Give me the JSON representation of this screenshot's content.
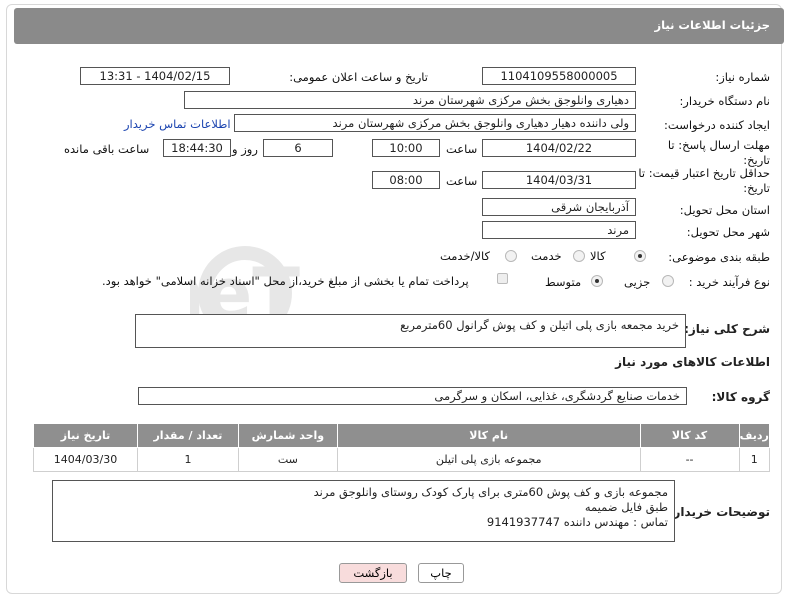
{
  "header": {
    "title": "جزئیات اطلاعات نیاز"
  },
  "need_number": {
    "label": "شماره نیاز:",
    "value": "1104109558000005"
  },
  "announce_datetime": {
    "label": "تاریخ و ساعت اعلان عمومی:",
    "value": "1404/02/15 - 13:31"
  },
  "buyer_org": {
    "label": "نام دستگاه خریدار:",
    "value": "دهیاری وانلوجق بخش مرکزی شهرستان مرند"
  },
  "requester": {
    "label": "ایجاد کننده درخواست:",
    "value": "ولی داننده دهیار دهیاری وانلوجق بخش مرکزی شهرستان مرند",
    "contact_link": "اطلاعات تماس خریدار"
  },
  "reply_deadline": {
    "label": "مهلت ارسال پاسخ: تا تاریخ:",
    "date": "1404/02/22",
    "time_label": "ساعت",
    "time": "10:00",
    "days": "6",
    "days_label": "روز و",
    "remaining": "18:44:30",
    "remaining_label": "ساعت باقی مانده"
  },
  "price_validity": {
    "label": "حداقل تاریخ اعتبار قیمت: تا تاریخ:",
    "date": "1404/03/31",
    "time_label": "ساعت",
    "time": "08:00"
  },
  "delivery_province": {
    "label": "استان محل تحویل:",
    "value": "آذربایجان شرقی"
  },
  "delivery_city": {
    "label": "شهر محل تحویل:",
    "value": "مرند"
  },
  "category": {
    "label": "طبقه بندی موضوعی:",
    "options": [
      "کالا",
      "خدمت",
      "کالا/خدمت"
    ],
    "selected": "کالا"
  },
  "purchase_process": {
    "label": "نوع فرآیند خرید :",
    "options": [
      "جزیی",
      "متوسط"
    ],
    "selected": "متوسط",
    "note": "پرداخت تمام یا بخشی از مبلغ خرید،از محل \"اسناد خزانه اسلامی\" خواهد بود."
  },
  "description": {
    "label": "شرح کلی نیاز:",
    "value": "خرید مجمعه بازی پلی اتیلن و کف پوش گرانول 60مترمربع"
  },
  "items_section": {
    "title": "اطلاعات کالاهای مورد نیاز"
  },
  "goods_group": {
    "label": "گروه کالا:",
    "value": "خدمات صنایع گردشگری، غذایی، اسکان و سرگرمی"
  },
  "table": {
    "headers": [
      "ردیف",
      "کد کالا",
      "نام کالا",
      "واحد شمارش",
      "تعداد / مقدار",
      "تاریخ نیاز"
    ],
    "rows": [
      [
        "1",
        "--",
        "مجموعه بازی پلی اتیلن",
        "ست",
        "1",
        "1404/03/30"
      ]
    ]
  },
  "buyer_notes": {
    "label": "توضیحات خریدار:",
    "lines": [
      "مجموعه بازی و کف پوش 60متری برای پارک کودک روستای وانلوجق مرند",
      "طبق فایل ضمیمه",
      "تماس : مهندس داننده 9141937747"
    ]
  },
  "buttons": {
    "print": "چاپ",
    "back": "بازگشت"
  },
  "watermark": {
    "text": "AriaTender.neT"
  },
  "colors": {
    "header_bg": "#8a8a8a",
    "link": "#1b44b0",
    "back_button_bg": "#f8dcdc"
  }
}
